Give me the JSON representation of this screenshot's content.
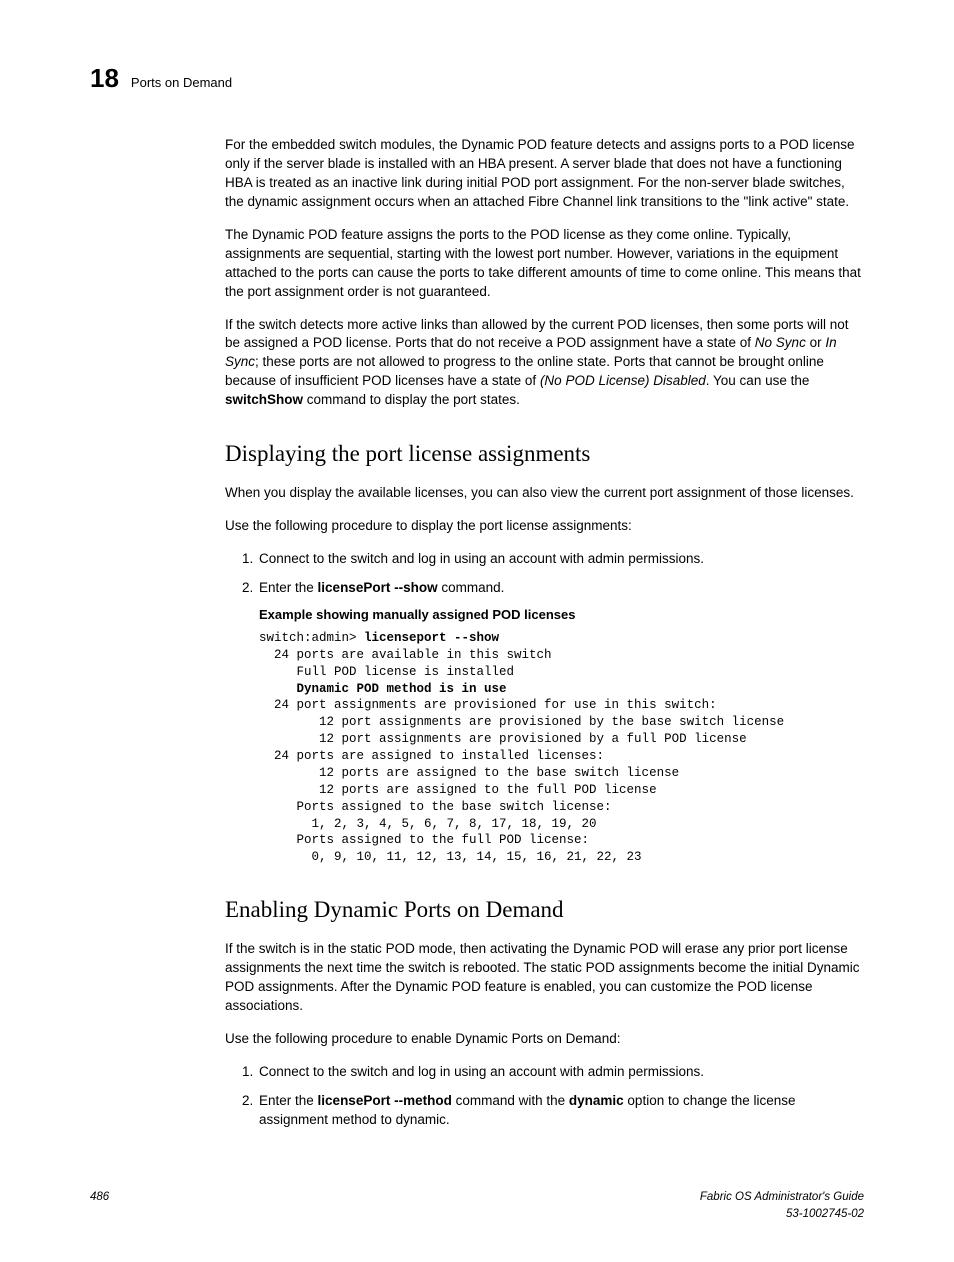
{
  "header": {
    "chapter": "18",
    "title": "Ports on Demand"
  },
  "body": {
    "p1": "For the embedded switch modules, the Dynamic POD feature detects and assigns ports to a POD license only if the server blade is installed with an HBA present. A server blade that does not have a functioning HBA is treated as an inactive link during initial POD port assignment. For the non-server blade switches, the dynamic assignment occurs when an attached Fibre Channel link transitions to the \"link active\" state.",
    "p2": "The Dynamic POD feature assigns the ports to the POD license as they come online. Typically, assignments are sequential, starting with the lowest port number. However, variations in the equipment attached to the ports can cause the ports to take different amounts of time to come online. This means that the port assignment order is not guaranteed.",
    "p3a": "If the switch detects more active links than allowed by the current POD licenses, then some ports will not be assigned a POD license. Ports that do not receive a POD assignment have a state of ",
    "p3_nosync": "No Sync",
    "p3_or": " or ",
    "p3_insync": "In Sync",
    "p3b": "; these ports are not allowed to progress to the online state. Ports that cannot be brought online because of insufficient POD licenses have a state of ",
    "p3_nopod": "(No POD License) Disabled",
    "p3c": ". You can use the ",
    "p3_cmd": "switchShow",
    "p3d": " command to display the port states.",
    "h2_display": "Displaying the port license assignments",
    "p4": "When you display the available licenses, you can also view the current port assignment of those licenses.",
    "p5": "Use the following procedure to display the port license assignments:",
    "ol1_li1": "Connect to the switch and log in using an account with admin permissions.",
    "ol1_li2a": "Enter the ",
    "ol1_li2_cmd": "licensePort  --show",
    "ol1_li2b": " command.",
    "example_label": "Example showing manually assigned POD licenses",
    "code_prompt": "switch:admin> ",
    "code_cmd": "licenseport --show",
    "code_l2": "  24 ports are available in this switch",
    "code_l3": "     Full POD license is installed",
    "code_l4": "     Dynamic POD method is in use",
    "code_l5": "  24 port assignments are provisioned for use in this switch:",
    "code_l6": "        12 port assignments are provisioned by the base switch license",
    "code_l7": "        12 port assignments are provisioned by a full POD license",
    "code_l8": "  24 ports are assigned to installed licenses:",
    "code_l9": "        12 ports are assigned to the base switch license",
    "code_l10": "        12 ports are assigned to the full POD license",
    "code_l11": "     Ports assigned to the base switch license:",
    "code_l12": "       1, 2, 3, 4, 5, 6, 7, 8, 17, 18, 19, 20",
    "code_l13": "     Ports assigned to the full POD license:",
    "code_l14": "       0, 9, 10, 11, 12, 13, 14, 15, 16, 21, 22, 23",
    "h2_enable": "Enabling Dynamic Ports on Demand",
    "p6": "If the switch is in the static POD mode, then activating the Dynamic POD will erase any prior port license assignments the next time the switch is rebooted. The static POD assignments become the initial Dynamic POD assignments. After the Dynamic POD feature is enabled, you can customize the POD license associations.",
    "p7": "Use the following procedure to enable Dynamic Ports on Demand:",
    "ol2_li1": "Connect to the switch and log in using an account with admin permissions.",
    "ol2_li2a": "Enter the ",
    "ol2_li2_cmd": "licensePort  --method",
    "ol2_li2b": " command with the ",
    "ol2_li2_dyn": "dynamic",
    "ol2_li2c": " option to change the license assignment method to dynamic."
  },
  "footer": {
    "page": "486",
    "doc_title": "Fabric OS Administrator's Guide",
    "doc_num": "53-1002745-02"
  }
}
